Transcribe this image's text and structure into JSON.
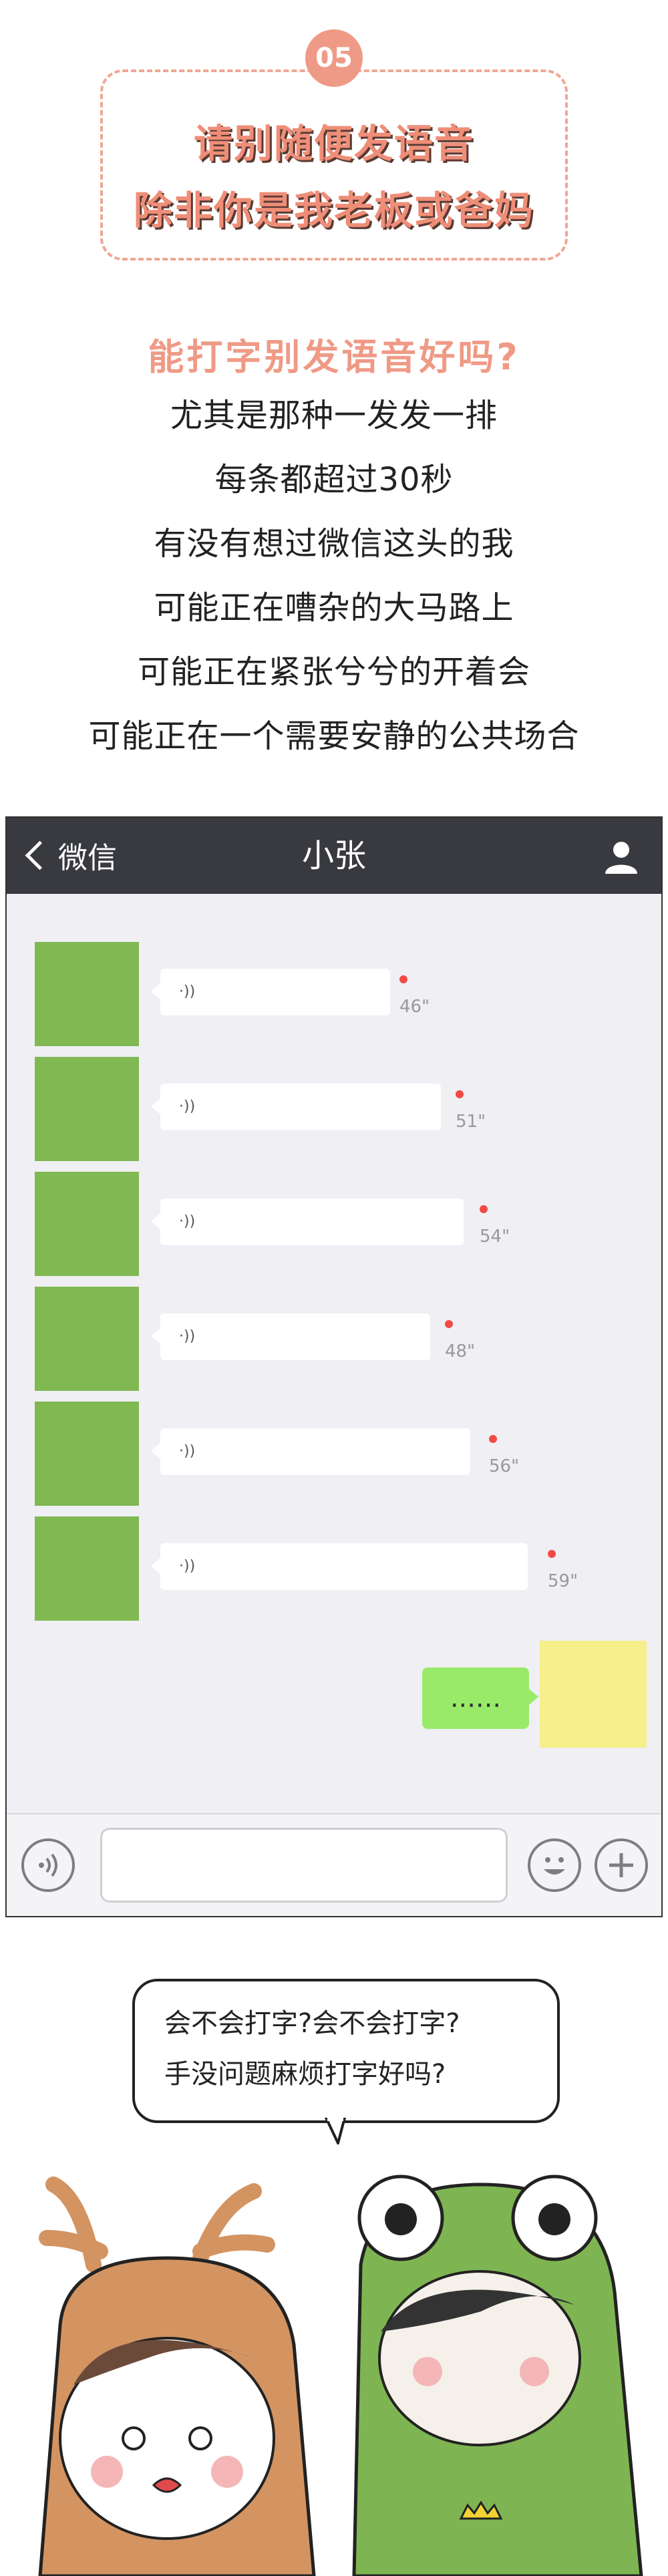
{
  "header": {
    "number": "05",
    "title_line1": "请别随便发语音",
    "title_line2": "除非你是我老板或爸妈"
  },
  "intro": {
    "subtitle": "能打字别发语音好吗?",
    "lines": [
      "尤其是那种一发发一排",
      "每条都超过30秒",
      "有没有想过微信这头的我",
      "可能正在嘈杂的大马路上",
      "可能正在紧张兮兮的开着会",
      "可能正在一个需要安静的公共场合"
    ]
  },
  "chat": {
    "back_label": "微信",
    "contact_name": "小张",
    "voice_messages": [
      {
        "duration": "46\""
      },
      {
        "duration": "51\""
      },
      {
        "duration": "54\""
      },
      {
        "duration": "48\""
      },
      {
        "duration": "56\""
      },
      {
        "duration": "59\""
      }
    ],
    "reply_text": "......",
    "colors": {
      "nav_bg": "#393a3f",
      "chat_bg": "#efeff4",
      "reply_bubble": "#9aea6a",
      "unread_dot": "#f14a45",
      "deer_avatar_bg": "#80b852",
      "frog_avatar_bg": "#f6ef8c"
    }
  },
  "comic": {
    "speech_line1": "会不会打字?会不会打字?",
    "speech_line2": "手没问题麻烦打字好吗?"
  },
  "icons": [
    "back-chevron-icon",
    "user-icon",
    "voice-wave-icon",
    "voice-input-icon",
    "emoji-icon",
    "plus-icon"
  ],
  "accent_color": "#ef9a86"
}
